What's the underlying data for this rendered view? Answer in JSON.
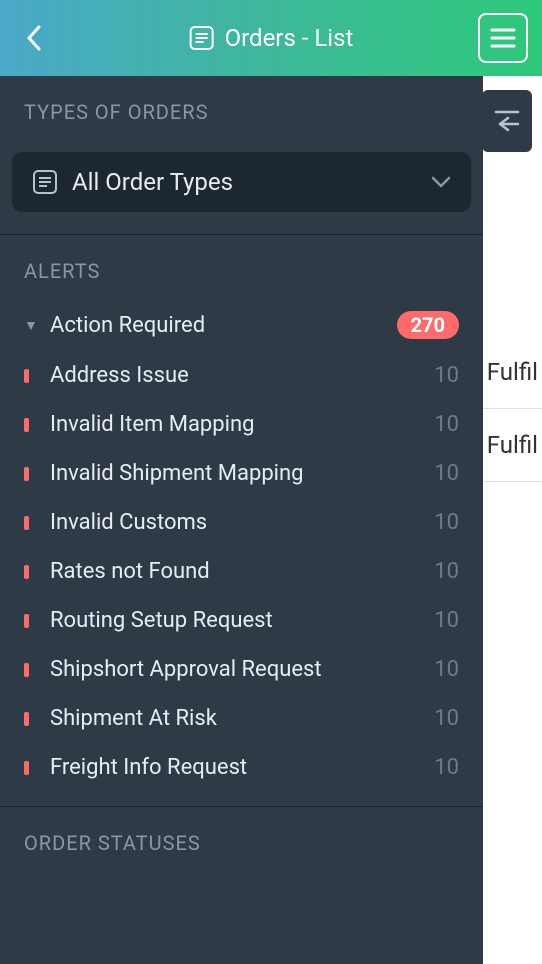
{
  "header": {
    "title": "Orders - List"
  },
  "bg": {
    "row1": "Fulfil",
    "row2": "Fulfil"
  },
  "sidebar": {
    "types_label": "TYPES OF ORDERS",
    "dropdown_value": "All Order Types",
    "alerts_label": "ALERTS",
    "action_required": {
      "label": "Action Required",
      "count": "270"
    },
    "items": [
      {
        "label": "Address Issue",
        "count": "10"
      },
      {
        "label": "Invalid Item Mapping",
        "count": "10"
      },
      {
        "label": "Invalid Shipment Mapping",
        "count": "10"
      },
      {
        "label": "Invalid Customs",
        "count": "10"
      },
      {
        "label": "Rates not Found",
        "count": "10"
      },
      {
        "label": "Routing Setup Request",
        "count": "10"
      },
      {
        "label": "Shipshort Approval Request",
        "count": "10"
      },
      {
        "label": "Shipment At Risk",
        "count": "10"
      },
      {
        "label": "Freight Info Request",
        "count": "10"
      }
    ],
    "statuses_label": "ORDER STATUSES"
  }
}
